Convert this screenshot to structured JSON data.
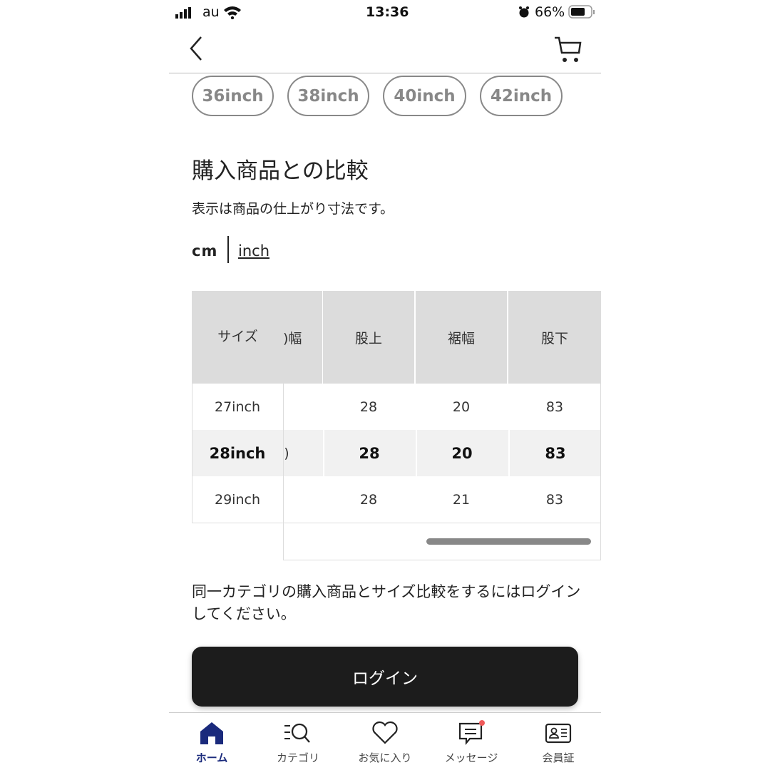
{
  "status_bar": {
    "carrier": "au",
    "time": "13:36",
    "battery": "66%"
  },
  "header": {
    "back_icon": "chevron-left-icon",
    "cart_icon": "cart-icon"
  },
  "size_chips": [
    "36inch",
    "38inch",
    "40inch",
    "42inch"
  ],
  "section": {
    "title": "購入商品との比較",
    "note": "表示は商品の仕上がり寸法です。",
    "unit_cm": "cm",
    "unit_inch": "inch"
  },
  "table": {
    "headers": [
      "サイズ",
      ")幅",
      "股上",
      "裾幅",
      "股下"
    ],
    "rows": [
      {
        "size": "27inch",
        "partial": "",
        "rise": "28",
        "hem": "20",
        "inseam": "83",
        "highlight": false
      },
      {
        "size": "28inch",
        "partial": ")",
        "rise": "28",
        "hem": "20",
        "inseam": "83",
        "highlight": true
      },
      {
        "size": "29inch",
        "partial": "",
        "rise": "28",
        "hem": "21",
        "inseam": "83",
        "highlight": false
      }
    ]
  },
  "login_prompt": "同一カテゴリの購入商品とサイズ比較をするにはログインしてください。",
  "login_button": "ログイン",
  "tab_bar": {
    "items": [
      {
        "label": "ホーム",
        "icon": "home-icon",
        "active": true
      },
      {
        "label": "カテゴリ",
        "icon": "category-search-icon"
      },
      {
        "label": "お気に入り",
        "icon": "heart-icon"
      },
      {
        "label": "メッセージ",
        "icon": "message-icon"
      },
      {
        "label": "会員証",
        "icon": "member-card-icon"
      }
    ]
  },
  "colors": {
    "accent": "#1a2a7c",
    "badge": "#ef5a5a",
    "button": "#1c1c1c"
  }
}
